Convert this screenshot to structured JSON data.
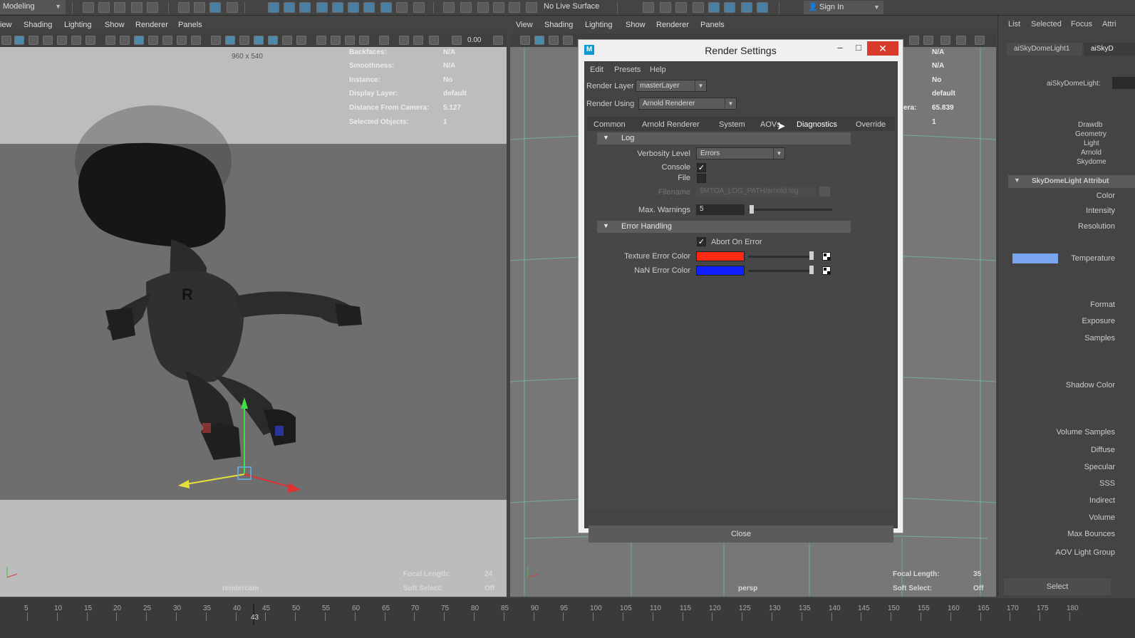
{
  "topbar": {
    "workspace": "Modeling",
    "live_surface": "No Live Surface",
    "sign_in": "Sign In"
  },
  "left_panel": {
    "menu": [
      "iew",
      "Shading",
      "Lighting",
      "Show",
      "Renderer",
      "Panels"
    ],
    "toolbar_value": "0.00",
    "resolution": "960 x 540",
    "hud": [
      {
        "label": "Backfaces:",
        "value": "N/A"
      },
      {
        "label": "Smoothness:",
        "value": "N/A"
      },
      {
        "label": "Instance:",
        "value": "No"
      },
      {
        "label": "Display Layer:",
        "value": "default"
      },
      {
        "label": "Distance From Camera:",
        "value": "5.127"
      },
      {
        "label": "Selected Objects:",
        "value": "1"
      }
    ],
    "focal_length_label": "Focal Length:",
    "focal_length": "24",
    "soft_select_label": "Soft Select:",
    "soft_select": "Off",
    "camera": "rendercam"
  },
  "right_panel": {
    "menu": [
      "View",
      "Shading",
      "Lighting",
      "Show",
      "Renderer",
      "Panels"
    ],
    "hud_values": [
      "N/A",
      "N/A",
      "No",
      "default",
      "65.839",
      "1"
    ],
    "hud_partial_label": "era:",
    "focal_length_label": "Focal Length:",
    "focal_length": "35",
    "soft_select_label": "Soft Select:",
    "soft_select": "Off",
    "camera": "persp"
  },
  "attr_panel": {
    "menu": [
      "List",
      "Selected",
      "Focus",
      "Attri"
    ],
    "tabs": [
      "aiSkyDomeLight1",
      "aiSkyD"
    ],
    "node_label": "aiSkyDomeLight:",
    "checkboxes": [
      "Drawdb",
      "Geometry",
      "Light",
      "Arnold",
      "Skydome"
    ],
    "section": "SkyDomeLight Attribut",
    "attrs": [
      "Color",
      "Intensity",
      "Resolution",
      "Temperature",
      "Format",
      "Exposure",
      "Samples",
      "Shadow Color",
      "Volume Samples",
      "Diffuse",
      "Specular",
      "SSS",
      "Indirect",
      "Volume",
      "Max Bounces",
      "AOV Light Group"
    ],
    "select_button": "Select"
  },
  "dialog": {
    "title": "Render Settings",
    "menu": [
      "Edit",
      "Presets",
      "Help"
    ],
    "render_layer_label": "Render Layer",
    "render_layer": "masterLayer",
    "render_using_label": "Render Using",
    "render_using": "Arnold Renderer",
    "tabs": [
      "Common",
      "Arnold Renderer",
      "System",
      "AOVs",
      "Diagnostics",
      "Override"
    ],
    "active_tab": "Diagnostics",
    "log": {
      "header": "Log",
      "verbosity_label": "Verbosity Level",
      "verbosity": "Errors",
      "console_label": "Console",
      "console_checked": true,
      "file_label": "File",
      "file_checked": false,
      "filename_label": "Filename",
      "filename": "$MTOA_LOG_PATH/arnold.log",
      "max_warnings_label": "Max. Warnings",
      "max_warnings": "5"
    },
    "error_handling": {
      "header": "Error Handling",
      "abort_label": "Abort On Error",
      "abort_checked": true,
      "texture_error_label": "Texture Error Color",
      "texture_error_color": "#ff2a16",
      "nan_error_label": "NaN Error Color",
      "nan_error_color": "#1020ff"
    },
    "close_button": "Close"
  },
  "timeline": {
    "current_frame": "43",
    "ticks": [
      "5",
      "10",
      "15",
      "20",
      "25",
      "30",
      "35",
      "40",
      "45",
      "50",
      "55",
      "60",
      "65",
      "70",
      "75",
      "80",
      "85",
      "90",
      "95",
      "100",
      "105",
      "110",
      "115",
      "120",
      "125",
      "130",
      "135",
      "140",
      "145",
      "150",
      "155",
      "160",
      "165",
      "170",
      "175",
      "180"
    ]
  }
}
